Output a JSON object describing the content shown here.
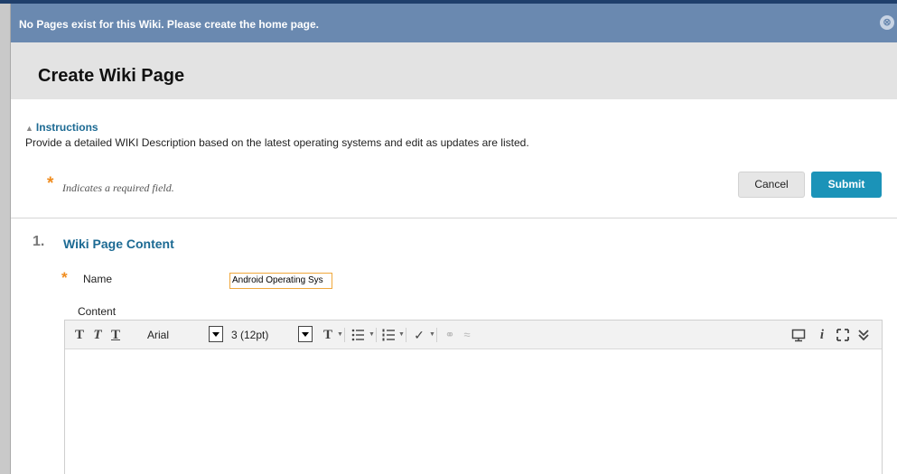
{
  "notice": {
    "text": "No Pages exist for this Wiki. Please create the home page.",
    "close_icon": "⊗"
  },
  "header": {
    "title": "Create Wiki Page"
  },
  "instructions": {
    "toggle_label": "Instructions",
    "text": "Provide a detailed WIKI Description based on the latest operating systems and edit as updates are listed."
  },
  "required_note": {
    "star": "*",
    "text": "Indicates a required field."
  },
  "buttons": {
    "cancel": "Cancel",
    "submit": "Submit"
  },
  "section": {
    "number": "1.",
    "title": "Wiki Page Content"
  },
  "form": {
    "name_label": "Name",
    "name_value": "Android Operating Sys",
    "content_label": "Content"
  },
  "toolbar": {
    "font_family": "Arial",
    "font_size": "3 (12pt)"
  },
  "colors": {
    "accent": "#1b93b8",
    "link": "#1c6a93",
    "notice_bg": "#6a89b0",
    "required": "#f08c1e"
  }
}
